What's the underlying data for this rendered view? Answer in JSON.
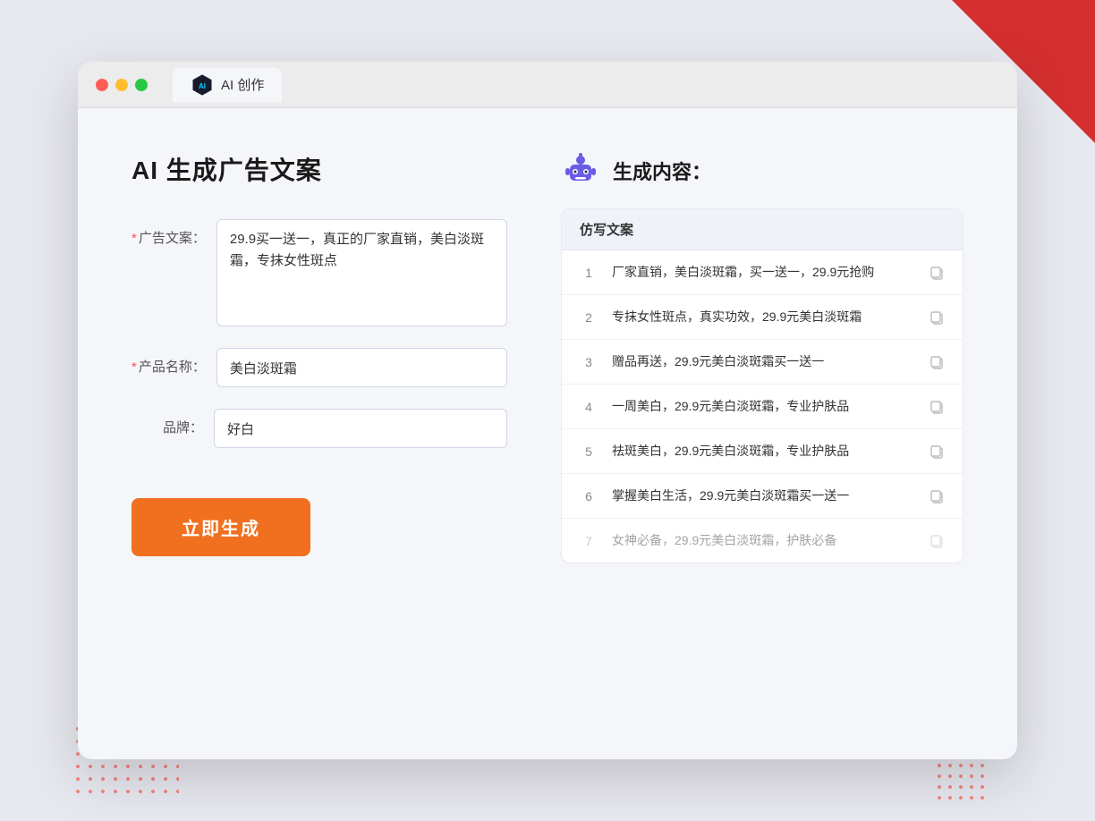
{
  "browser": {
    "tab_label": "AI 创作"
  },
  "page": {
    "title": "AI 生成广告文案",
    "right_title": "生成内容："
  },
  "form": {
    "ad_copy_label": "广告文案：",
    "ad_copy_value": "29.9买一送一，真正的厂家直销，美白淡斑霜，专抹女性斑点",
    "ad_copy_placeholder": "",
    "product_name_label": "产品名称：",
    "product_name_value": "美白淡斑霜",
    "brand_label": "品牌：",
    "brand_value": "好白",
    "generate_btn_label": "立即生成"
  },
  "results": {
    "column_header": "仿写文案",
    "items": [
      {
        "number": "1",
        "text": "厂家直销，美白淡斑霜，买一送一，29.9元抢购",
        "dimmed": false
      },
      {
        "number": "2",
        "text": "专抹女性斑点，真实功效，29.9元美白淡斑霜",
        "dimmed": false
      },
      {
        "number": "3",
        "text": "赠品再送，29.9元美白淡斑霜买一送一",
        "dimmed": false
      },
      {
        "number": "4",
        "text": "一周美白，29.9元美白淡斑霜，专业护肤品",
        "dimmed": false
      },
      {
        "number": "5",
        "text": "祛斑美白，29.9元美白淡斑霜，专业护肤品",
        "dimmed": false
      },
      {
        "number": "6",
        "text": "掌握美白生活，29.9元美白淡斑霜买一送一",
        "dimmed": false
      },
      {
        "number": "7",
        "text": "女神必备，29.9元美白淡斑霜，护肤必备",
        "dimmed": true
      }
    ]
  }
}
